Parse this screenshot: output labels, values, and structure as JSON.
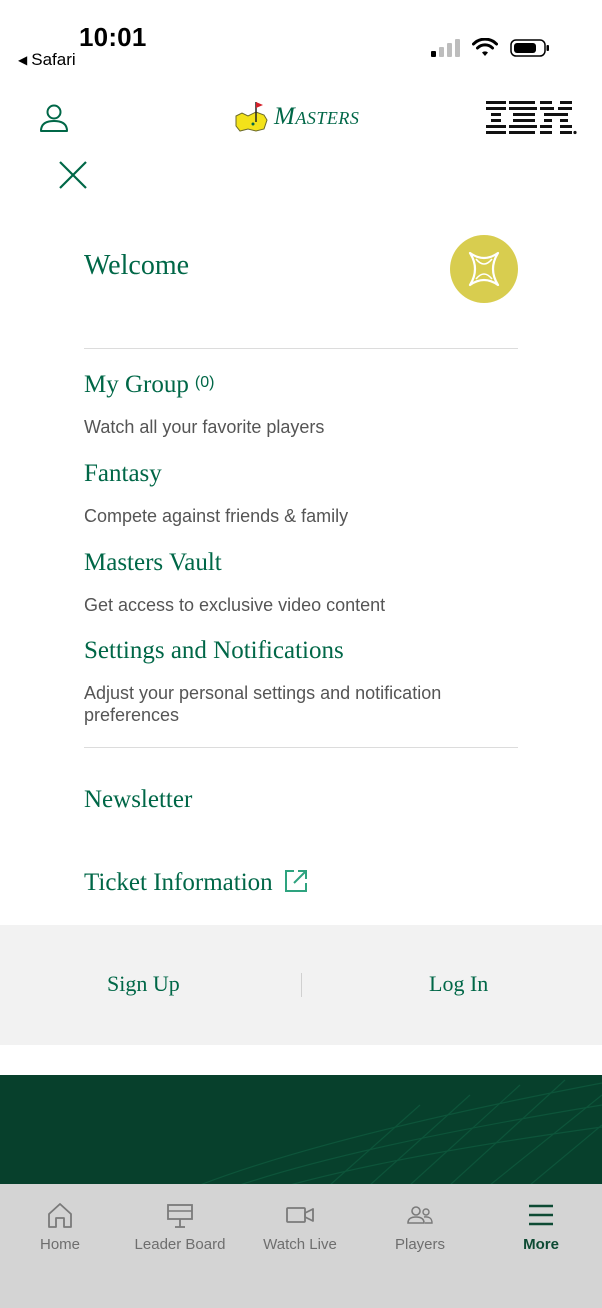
{
  "status_bar": {
    "time": "10:01",
    "back_app": "Safari"
  },
  "header": {
    "brand": "Masters",
    "partner": "IBM"
  },
  "menu": {
    "welcome": "Welcome",
    "items": [
      {
        "title": "My Group",
        "count": "(0)",
        "subtitle": "Watch all your favorite players"
      },
      {
        "title": "Fantasy",
        "subtitle": "Compete against friends & family"
      },
      {
        "title": "Masters Vault",
        "subtitle": "Get access to exclusive video content"
      },
      {
        "title": "Settings and Notifications",
        "subtitle": "Adjust your personal settings and notification preferences"
      }
    ],
    "newsletter": "Newsletter",
    "tickets": "Ticket Information"
  },
  "auth": {
    "signup": "Sign Up",
    "login": "Log In"
  },
  "tabs": [
    {
      "label": "Home",
      "icon": "home-icon"
    },
    {
      "label": "Leader Board",
      "icon": "leaderboard-icon"
    },
    {
      "label": "Watch Live",
      "icon": "video-icon"
    },
    {
      "label": "Players",
      "icon": "players-icon"
    },
    {
      "label": "More",
      "icon": "menu-icon",
      "active": true
    }
  ],
  "colors": {
    "brand_green": "#006747",
    "accent_yellow": "#d8cd4f",
    "dark_green": "#07402c"
  }
}
